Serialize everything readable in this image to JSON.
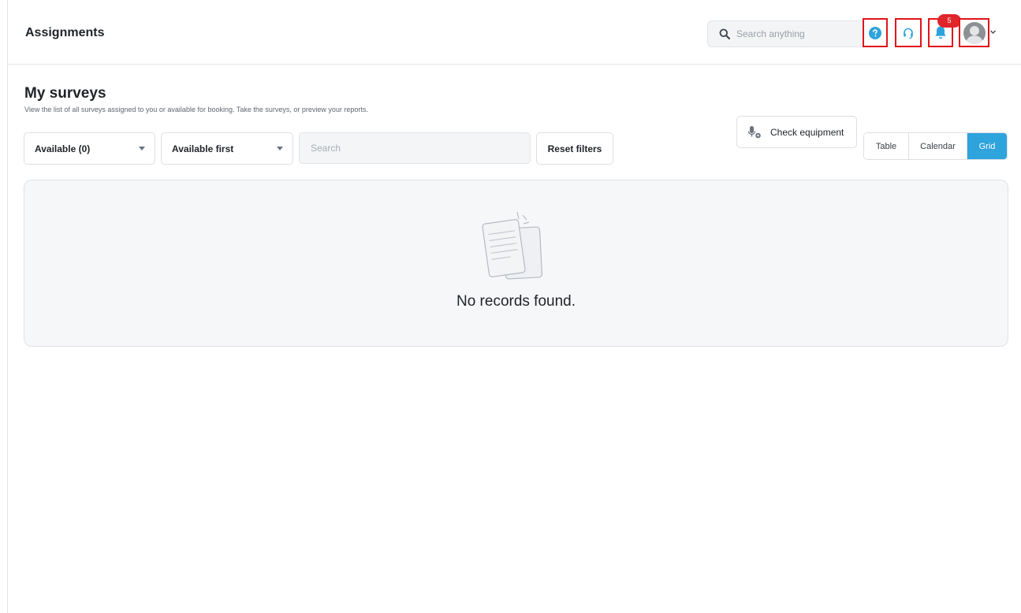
{
  "header": {
    "title": "Assignments",
    "search_placeholder": "Search anything",
    "notification_count": "5",
    "icons": [
      "search-icon",
      "help-icon",
      "headset-icon",
      "bell-icon",
      "avatar",
      "chevron-down-icon"
    ]
  },
  "page": {
    "title": "My surveys",
    "subtitle": "View the list of all surveys assigned to you or available for booking. Take the surveys, or preview your reports."
  },
  "filters": {
    "availability": "Available (0)",
    "sort": "Available first",
    "search_placeholder": "Search",
    "reset_label": "Reset filters"
  },
  "actions": {
    "check_equipment_label": "Check equipment"
  },
  "view_toggle": {
    "options": [
      "Table",
      "Calendar",
      "Grid"
    ],
    "selected": "Grid"
  },
  "empty_state": {
    "message": "No records found."
  },
  "colors": {
    "accent": "#2ea3dc",
    "highlight_box": "#e0141b",
    "badge": "#e0262a"
  }
}
